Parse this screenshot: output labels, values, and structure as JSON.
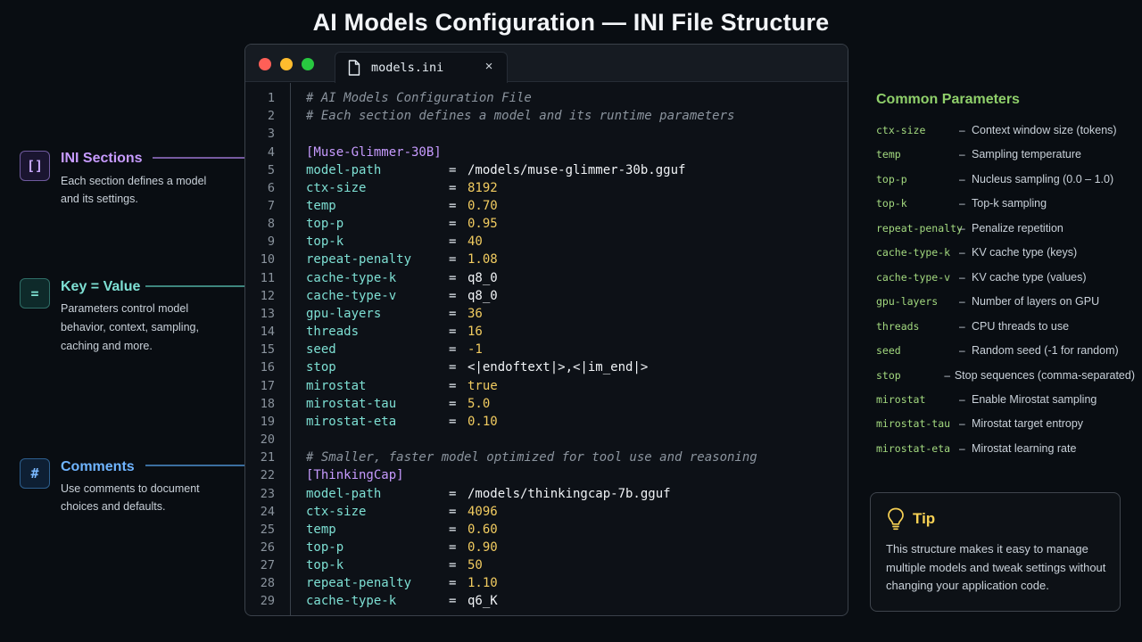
{
  "page": {
    "title": "AI Models Configuration — INI File Structure"
  },
  "annotations": {
    "sections": {
      "icon": "[]",
      "icon_name": "brackets-icon",
      "title": "INI Sections",
      "desc": "Each section defines a model and its settings."
    },
    "keyvalue": {
      "icon": "=",
      "icon_name": "equals-icon",
      "title": "Key = Value",
      "desc": "Parameters control model behavior, context, sampling, caching and more."
    },
    "comments": {
      "icon": "#",
      "icon_name": "hash-icon",
      "title": "Comments",
      "desc": "Use comments to document choices and defaults."
    }
  },
  "editor": {
    "tab": {
      "filename": "models.ini",
      "close": "×",
      "icon": "file-icon"
    },
    "lines": [
      {
        "n": "1",
        "kind": "comment",
        "text": "# AI Models Configuration File"
      },
      {
        "n": "2",
        "kind": "comment",
        "text": "# Each section defines a model and its runtime parameters"
      },
      {
        "n": "3",
        "kind": "blank"
      },
      {
        "n": "4",
        "kind": "section",
        "text": "[Muse-Glimmer-30B]"
      },
      {
        "n": "5",
        "kind": "kv",
        "key": "model-path",
        "eq": "=",
        "value": "/models/muse-glimmer-30b.gguf",
        "vtype": "str"
      },
      {
        "n": "6",
        "kind": "kv",
        "key": "ctx-size",
        "eq": "=",
        "value": "8192",
        "vtype": "num"
      },
      {
        "n": "7",
        "kind": "kv",
        "key": "temp",
        "eq": "=",
        "value": "0.70",
        "vtype": "num"
      },
      {
        "n": "8",
        "kind": "kv",
        "key": "top-p",
        "eq": "=",
        "value": "0.95",
        "vtype": "num"
      },
      {
        "n": "9",
        "kind": "kv",
        "key": "top-k",
        "eq": "=",
        "value": "40",
        "vtype": "num"
      },
      {
        "n": "10",
        "kind": "kv",
        "key": "repeat-penalty",
        "eq": "=",
        "value": "1.08",
        "vtype": "num"
      },
      {
        "n": "11",
        "kind": "kv",
        "key": "cache-type-k",
        "eq": "=",
        "value": "q8_0",
        "vtype": "str"
      },
      {
        "n": "12",
        "kind": "kv",
        "key": "cache-type-v",
        "eq": "=",
        "value": "q8_0",
        "vtype": "str"
      },
      {
        "n": "13",
        "kind": "kv",
        "key": "gpu-layers",
        "eq": "=",
        "value": "36",
        "vtype": "num"
      },
      {
        "n": "14",
        "kind": "kv",
        "key": "threads",
        "eq": "=",
        "value": "16",
        "vtype": "num"
      },
      {
        "n": "15",
        "kind": "kv",
        "key": "seed",
        "eq": "=",
        "value": "-1",
        "vtype": "num"
      },
      {
        "n": "16",
        "kind": "kv",
        "key": "stop",
        "eq": "=",
        "value": "<|endoftext|>,<|im_end|>",
        "vtype": "str"
      },
      {
        "n": "17",
        "kind": "kv",
        "key": "mirostat",
        "eq": "=",
        "value": "true",
        "vtype": "num"
      },
      {
        "n": "18",
        "kind": "kv",
        "key": "mirostat-tau",
        "eq": "=",
        "value": "5.0",
        "vtype": "num"
      },
      {
        "n": "19",
        "kind": "kv",
        "key": "mirostat-eta",
        "eq": "=",
        "value": "0.10",
        "vtype": "num"
      },
      {
        "n": "20",
        "kind": "blank"
      },
      {
        "n": "21",
        "kind": "comment",
        "text": "# Smaller, faster model optimized for tool use and reasoning"
      },
      {
        "n": "22",
        "kind": "section",
        "text": "[ThinkingCap]"
      },
      {
        "n": "23",
        "kind": "kv",
        "key": "model-path",
        "eq": "=",
        "value": "/models/thinkingcap-7b.gguf",
        "vtype": "str"
      },
      {
        "n": "24",
        "kind": "kv",
        "key": "ctx-size",
        "eq": "=",
        "value": "4096",
        "vtype": "num"
      },
      {
        "n": "25",
        "kind": "kv",
        "key": "temp",
        "eq": "=",
        "value": "0.60",
        "vtype": "num"
      },
      {
        "n": "26",
        "kind": "kv",
        "key": "top-p",
        "eq": "=",
        "value": "0.90",
        "vtype": "num"
      },
      {
        "n": "27",
        "kind": "kv",
        "key": "top-k",
        "eq": "=",
        "value": "50",
        "vtype": "num"
      },
      {
        "n": "28",
        "kind": "kv",
        "key": "repeat-penalty",
        "eq": "=",
        "value": "1.10",
        "vtype": "num"
      },
      {
        "n": "29",
        "kind": "kv",
        "key": "cache-type-k",
        "eq": "=",
        "value": "q6_K",
        "vtype": "str"
      }
    ]
  },
  "params": {
    "title": "Common Parameters",
    "dash": "–",
    "items": [
      {
        "key": "ctx-size",
        "desc": "Context window size (tokens)"
      },
      {
        "key": "temp",
        "desc": "Sampling temperature"
      },
      {
        "key": "top-p",
        "desc": "Nucleus sampling (0.0 – 1.0)"
      },
      {
        "key": "top-k",
        "desc": "Top-k sampling"
      },
      {
        "key": "repeat-penalty",
        "desc": "Penalize repetition"
      },
      {
        "key": "cache-type-k",
        "desc": "KV cache type (keys)"
      },
      {
        "key": "cache-type-v",
        "desc": "KV cache type (values)"
      },
      {
        "key": "gpu-layers",
        "desc": "Number of layers on GPU"
      },
      {
        "key": "threads",
        "desc": "CPU threads to use"
      },
      {
        "key": "seed",
        "desc": "Random seed (-1 for random)"
      },
      {
        "key": "stop",
        "desc": "Stop sequences (comma-separated)"
      },
      {
        "key": "mirostat",
        "desc": "Enable Mirostat sampling"
      },
      {
        "key": "mirostat-tau",
        "desc": "Mirostat target entropy"
      },
      {
        "key": "mirostat-eta",
        "desc": "Mirostat learning rate"
      }
    ]
  },
  "tip": {
    "icon": "lightbulb-icon",
    "title": "Tip",
    "body": "This structure makes it easy to manage multiple models and tweak settings without changing your application code."
  },
  "colors": {
    "background": "#090d12",
    "section": "#c79bff",
    "key": "#7ee0d4",
    "number": "#f2cc60",
    "comment": "#8b949e",
    "param_key": "#a3d97f",
    "params_title": "#8fcf6a",
    "tip_title": "#f7d154",
    "comments_accent": "#6fb4ff"
  }
}
